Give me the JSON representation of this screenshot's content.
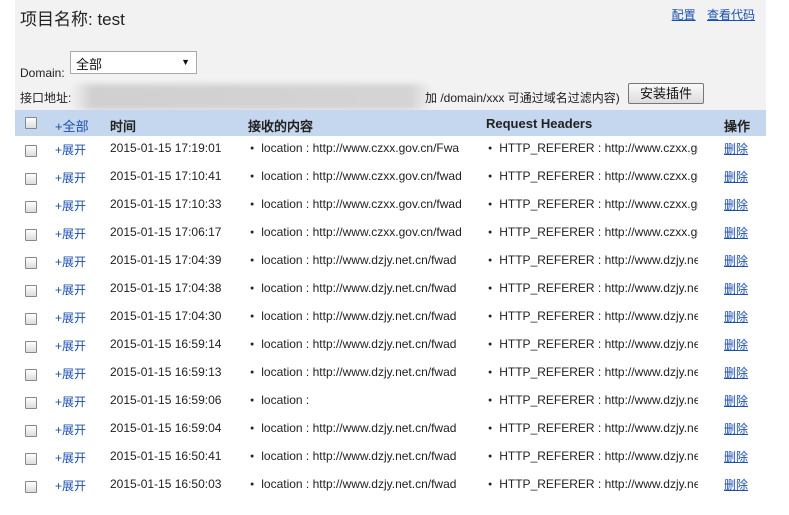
{
  "header": {
    "title": "项目名称: test",
    "config_link": "配置",
    "view_code_link": "查看代码"
  },
  "domain": {
    "label": "Domain:",
    "selected": "全部"
  },
  "api": {
    "label": "接口地址:",
    "hint": "加 /domain/xxx 可通过域名过滤内容)",
    "install_button": "安装插件"
  },
  "table": {
    "headers": {
      "expand_all": "+全部",
      "time": "时间",
      "content": "接收的内容",
      "request_headers": "Request Headers",
      "action": "操作"
    },
    "rows": [
      {
        "expand": "+展开",
        "time": "2015-01-15 17:19:01",
        "location": "location : http://www.czxx.gov.cn/Fwa",
        "referer": "HTTP_REFERER : http://www.czxx.go",
        "delete": "删除"
      },
      {
        "expand": "+展开",
        "time": "2015-01-15 17:10:41",
        "location": "location : http://www.czxx.gov.cn/fwad",
        "referer": "HTTP_REFERER : http://www.czxx.go",
        "delete": "删除"
      },
      {
        "expand": "+展开",
        "time": "2015-01-15 17:10:33",
        "location": "location : http://www.czxx.gov.cn/fwad",
        "referer": "HTTP_REFERER : http://www.czxx.go",
        "delete": "删除"
      },
      {
        "expand": "+展开",
        "time": "2015-01-15 17:06:17",
        "location": "location : http://www.czxx.gov.cn/fwad",
        "referer": "HTTP_REFERER : http://www.czxx.go",
        "delete": "删除"
      },
      {
        "expand": "+展开",
        "time": "2015-01-15 17:04:39",
        "location": "location : http://www.dzjy.net.cn/fwad",
        "referer": "HTTP_REFERER : http://www.dzjy.ne",
        "delete": "删除"
      },
      {
        "expand": "+展开",
        "time": "2015-01-15 17:04:38",
        "location": "location : http://www.dzjy.net.cn/fwad",
        "referer": "HTTP_REFERER : http://www.dzjy.ne",
        "delete": "删除"
      },
      {
        "expand": "+展开",
        "time": "2015-01-15 17:04:30",
        "location": "location : http://www.dzjy.net.cn/fwad",
        "referer": "HTTP_REFERER : http://www.dzjy.ne",
        "delete": "删除"
      },
      {
        "expand": "+展开",
        "time": "2015-01-15 16:59:14",
        "location": "location : http://www.dzjy.net.cn/fwad",
        "referer": "HTTP_REFERER : http://www.dzjy.ne",
        "delete": "删除"
      },
      {
        "expand": "+展开",
        "time": "2015-01-15 16:59:13",
        "location": "location : http://www.dzjy.net.cn/fwad",
        "referer": "HTTP_REFERER : http://www.dzjy.ne",
        "delete": "删除"
      },
      {
        "expand": "+展开",
        "time": "2015-01-15 16:59:06",
        "location": "location :",
        "referer": "HTTP_REFERER : http://www.dzjy.ne",
        "delete": "删除"
      },
      {
        "expand": "+展开",
        "time": "2015-01-15 16:59:04",
        "location": "location : http://www.dzjy.net.cn/fwad",
        "referer": "HTTP_REFERER : http://www.dzjy.ne",
        "delete": "删除"
      },
      {
        "expand": "+展开",
        "time": "2015-01-15 16:50:41",
        "location": "location : http://www.dzjy.net.cn/fwad",
        "referer": "HTTP_REFERER : http://www.dzjy.ne",
        "delete": "删除"
      },
      {
        "expand": "+展开",
        "time": "2015-01-15 16:50:03",
        "location": "location : http://www.dzjy.net.cn/fwad",
        "referer": "HTTP_REFERER : http://www.dzjy.ne",
        "delete": "删除"
      }
    ]
  }
}
